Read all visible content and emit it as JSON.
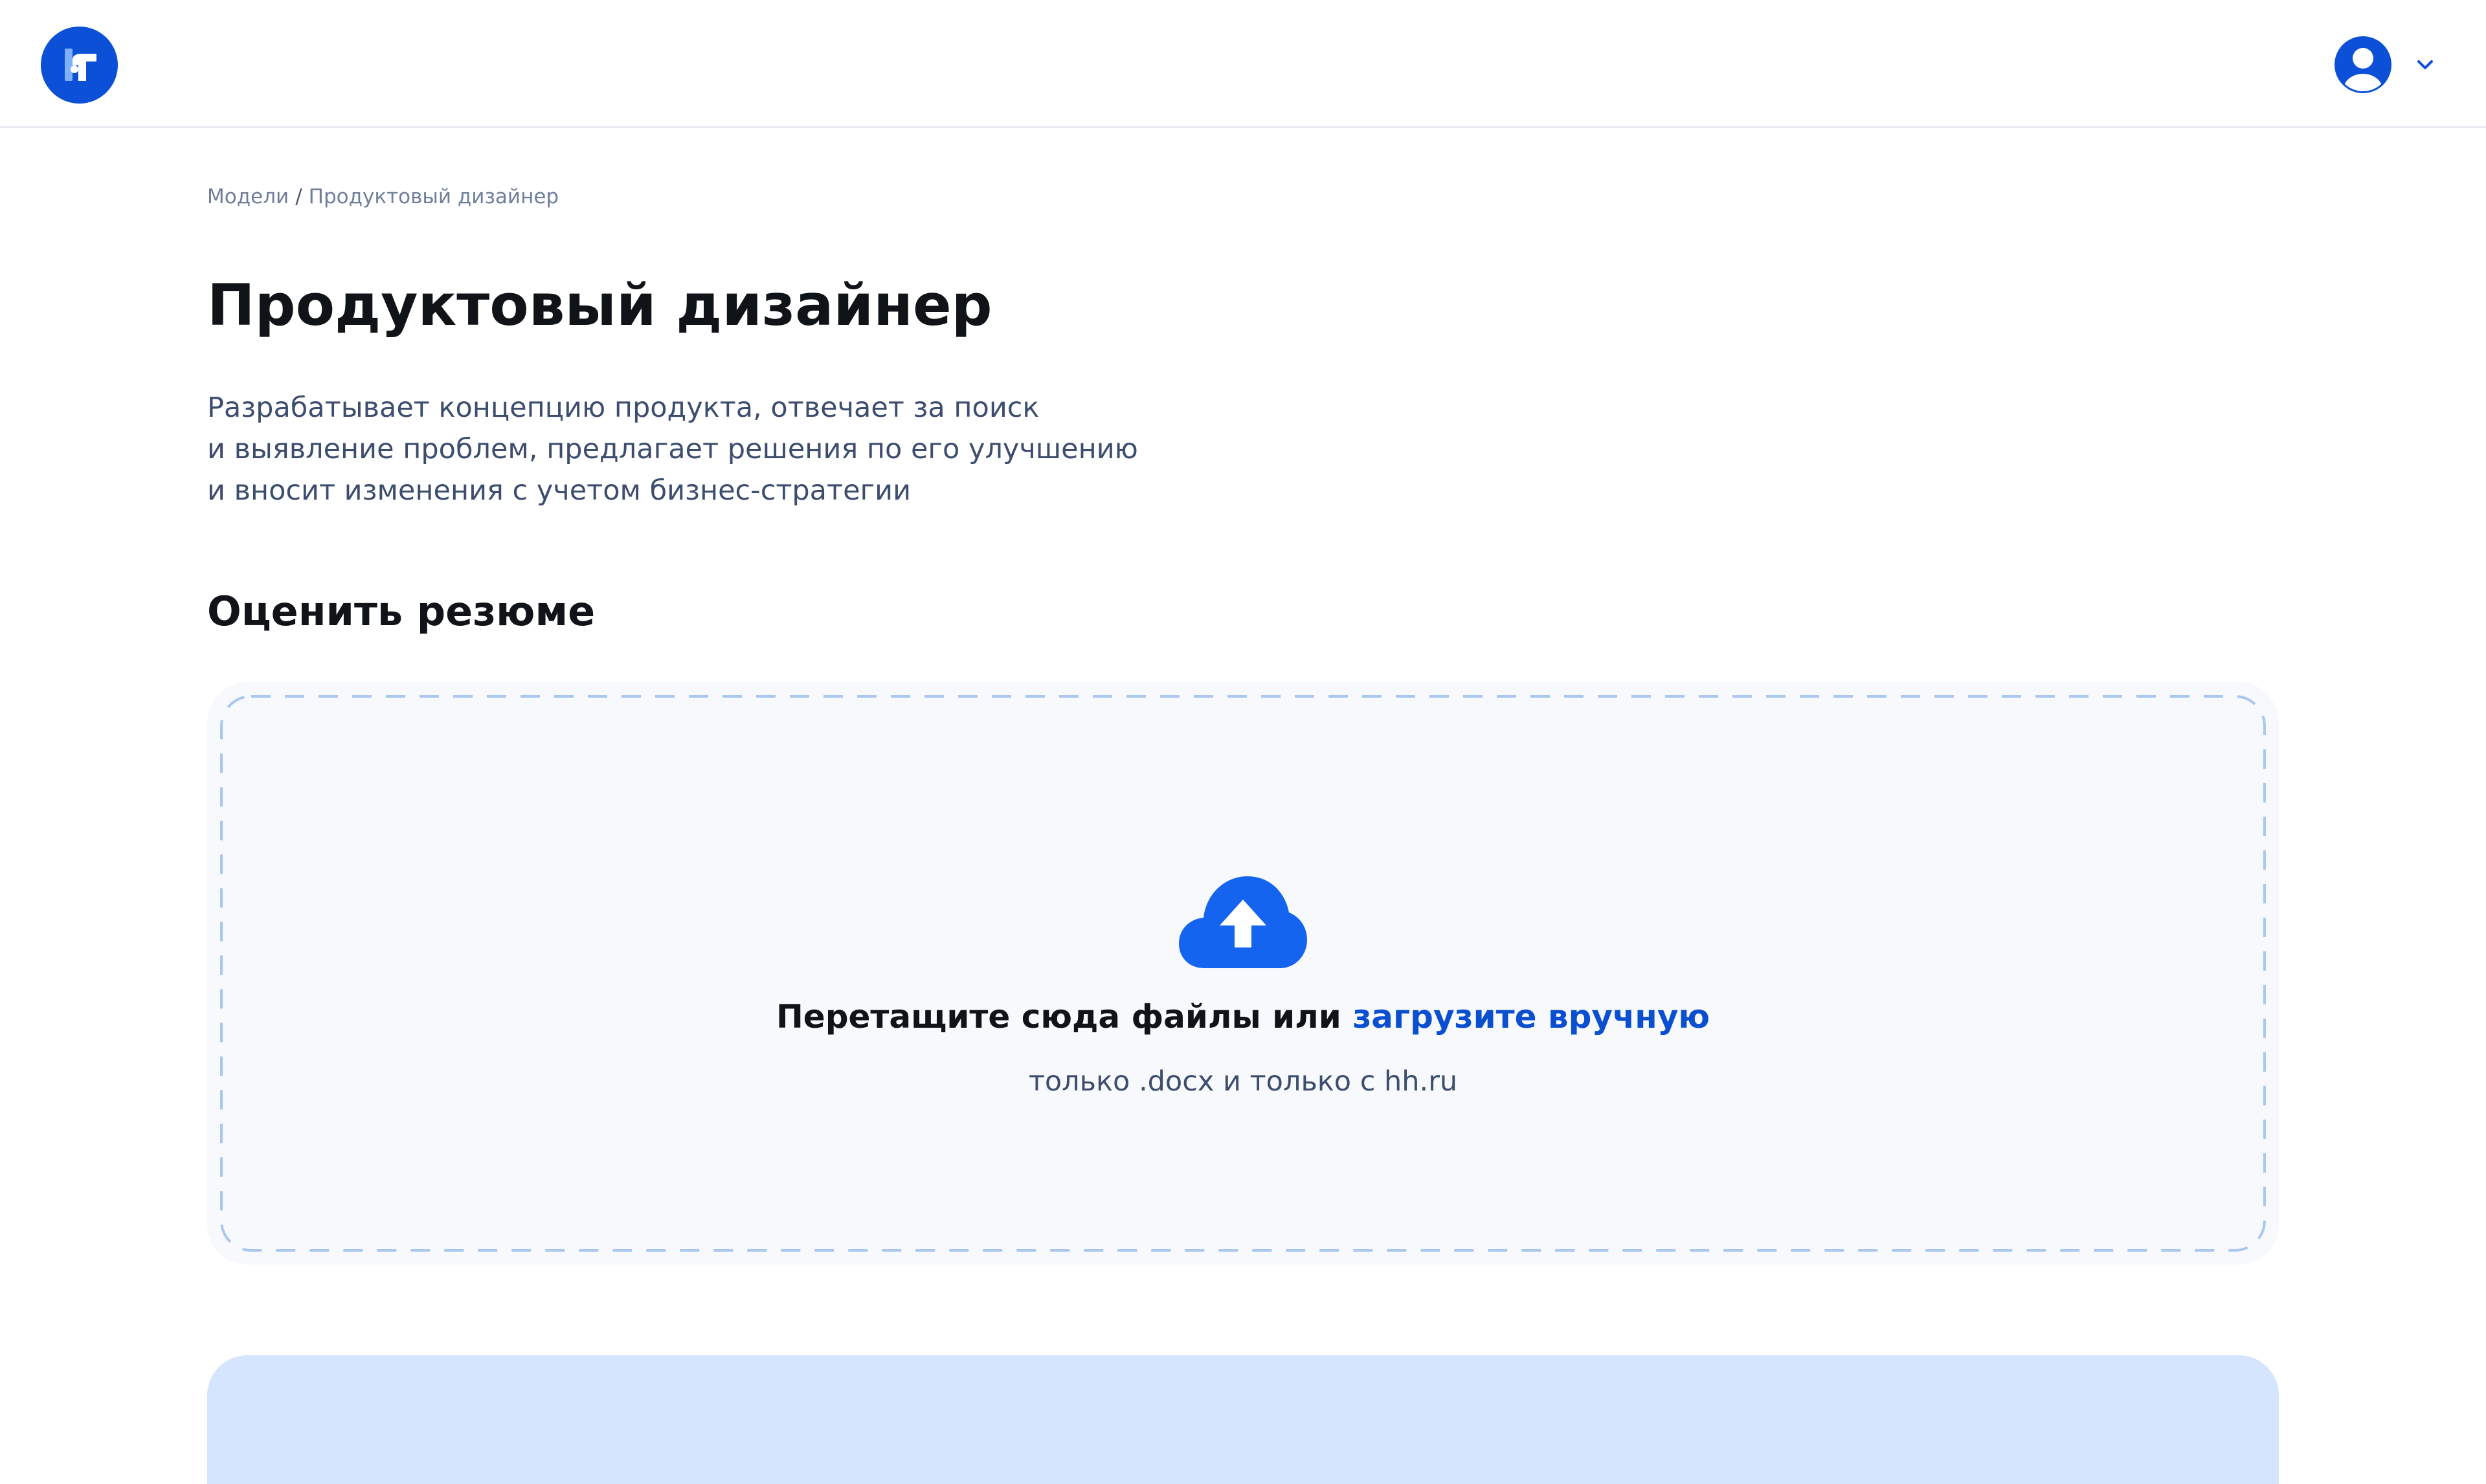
{
  "header": {
    "logo_icon": "hr-logo-icon",
    "user_icon": "user-avatar-icon",
    "menu_icon": "chevron-down-icon"
  },
  "breadcrumb": {
    "items": [
      "Модели",
      "Продуктовый дизайнер"
    ],
    "separator": "/"
  },
  "page": {
    "title": "Продуктовый дизайнер",
    "description_lines": [
      "Разрабатывает концепцию продукта, отвечает за поиск",
      "и выявление проблем, предлагает решения по его улучшению",
      "и вносит изменения с учетом бизнес-стратегии"
    ]
  },
  "upload": {
    "section_title": "Оценить резюме",
    "icon": "cloud-upload-icon",
    "drop_text": "Перетащите сюда файлы или",
    "link_text": "загрузите вручную",
    "hint": "только .docx и только с hh.ru"
  },
  "colors": {
    "brand": "#0b50d6",
    "link": "#0b4fd1",
    "upload_icon": "#1464f0",
    "dropzone_bg": "#f7f9fc",
    "dashed_border": "#a9c7ef",
    "result_card_bg": "#d6e5fe"
  }
}
